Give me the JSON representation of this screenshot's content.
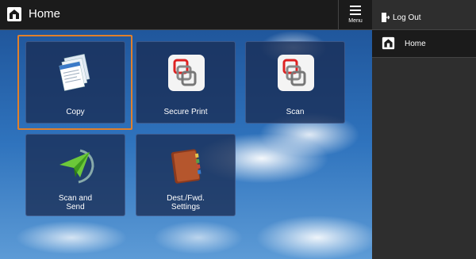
{
  "header": {
    "title": "Home",
    "menu_label": "Menu"
  },
  "tiles": [
    {
      "label": "Copy"
    },
    {
      "label": "Secure Print"
    },
    {
      "label": "Scan"
    },
    {
      "label_line1": "Scan and",
      "label_line2": "Send"
    },
    {
      "label_line1": "Dest./Fwd.",
      "label_line2": "Settings"
    }
  ],
  "sidebar": {
    "logout_label": "Log Out",
    "home_label": "Home"
  },
  "colors": {
    "focus": "#e0802c",
    "topbar": "#1b1b1b",
    "sidebar": "#2e2e2e"
  }
}
